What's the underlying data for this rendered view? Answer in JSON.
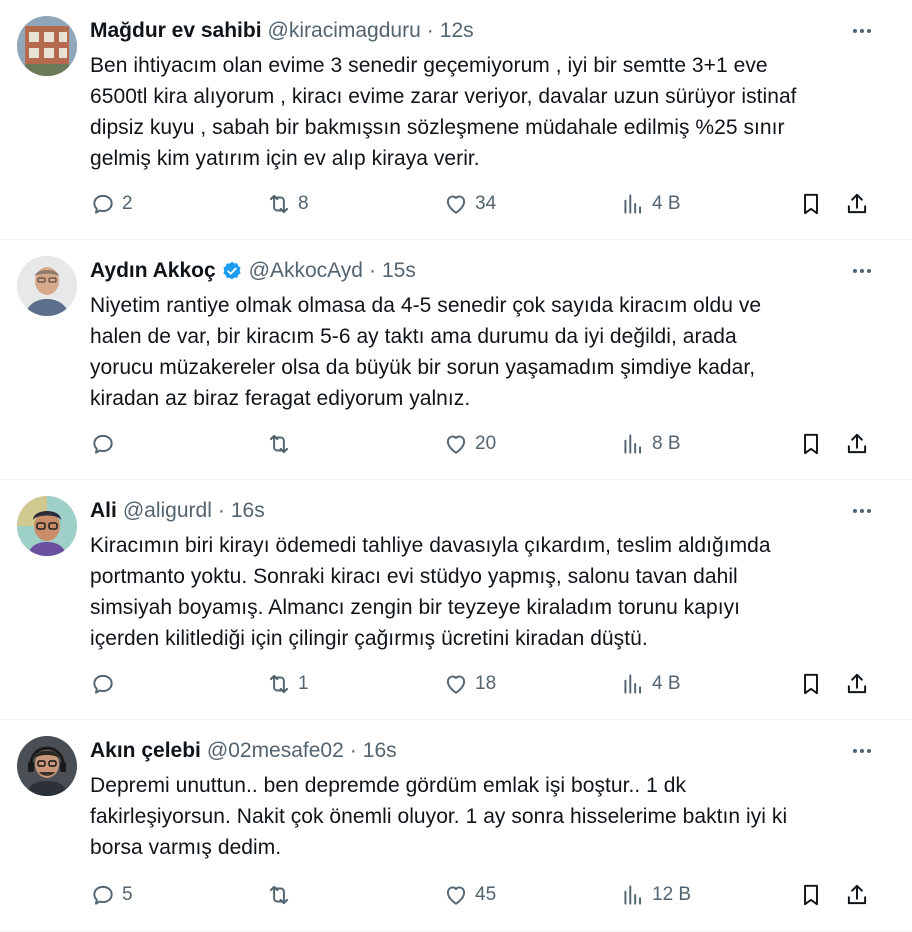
{
  "colors": {
    "text": "#0f1419",
    "muted": "#536471",
    "verified": "#1d9bf0",
    "divider": "#eff3f4"
  },
  "tweets": [
    {
      "name": "Mağdur ev sahibi",
      "handle": "@kiracimagduru",
      "time": "12s",
      "verified": false,
      "avatar_icon": "building-photo",
      "text": "Ben ihtiyacım olan evime 3 senedir geçemiyorum , iyi bir semtte 3+1 eve\n6500tl kira alıyorum , kiracı evime zarar veriyor, davalar uzun sürüyor istinaf\ndipsiz kuyu , sabah bir bakmışsın sözleşmene müdahale edilmiş %25 sınır\ngelmiş kim yatırım için ev alıp kiraya verir.",
      "replies": "2",
      "retweets": "8",
      "likes": "34",
      "views": "4 B"
    },
    {
      "name": "Aydın Akkoç",
      "handle": "@AkkocAyd",
      "time": "15s",
      "verified": true,
      "avatar_icon": "man-portrait-photo",
      "text": "Niyetim rantiye olmak olmasa da 4-5 senedir çok sayıda kiracım oldu ve\nhalen de var, bir kiracım 5-6 ay taktı ama durumu da iyi değildi, arada\nyorucu müzakereler olsa da büyük bir sorun yaşamadım şimdiye kadar,\nkiradan az biraz feragat ediyorum yalnız.",
      "replies": "",
      "retweets": "",
      "likes": "20",
      "views": "8 B"
    },
    {
      "name": "Ali",
      "handle": "@aligurdl",
      "time": "16s",
      "verified": false,
      "avatar_icon": "illustrated-avatar",
      "text": "Kiracımın biri kirayı ödemedi tahliye davasıyla çıkardım, teslim aldığımda\nportmanto yoktu. Sonraki kiracı evi stüdyo yapmış, salonu tavan dahil\nsimsiyah boyamış. Almancı zengin bir teyzeye kiraladım torunu kapıyı\niçerden kilitlediği için çilingir çağırmış ücretini kiradan düştü.",
      "replies": "",
      "retweets": "1",
      "likes": "18",
      "views": "4 B"
    },
    {
      "name": "Akın çelebi",
      "handle": "@02mesafe02",
      "time": "16s",
      "verified": false,
      "avatar_icon": "man-headphones-photo",
      "text": "Depremi unuttun.. ben depremde gördüm emlak işi boştur.. 1 dk\nfakirleşiyorsun. Nakit çok önemli oluyor. 1 ay sonra hisselerime baktın iyi ki\nborsa varmış dedim.",
      "replies": "5",
      "retweets": "",
      "likes": "45",
      "views": "12 B"
    }
  ]
}
